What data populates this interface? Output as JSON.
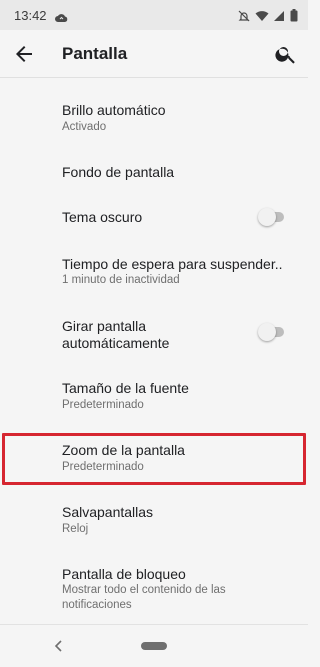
{
  "status_bar": {
    "time": "13:42",
    "icons": [
      "cloud-sync-icon",
      "mute-icon",
      "wifi-icon",
      "signal-icon",
      "battery-icon"
    ]
  },
  "app_bar": {
    "title": "Pantalla",
    "back_icon": "arrow-back-icon",
    "search_icon": "search-icon"
  },
  "settings": {
    "items": [
      {
        "title": "Brillo automático",
        "subtitle": "Activado"
      },
      {
        "title": "Fondo de pantalla"
      },
      {
        "title": "Tema oscuro",
        "toggle": false
      },
      {
        "title": "Tiempo de espera para suspender..",
        "subtitle": "1 minuto de inactividad"
      },
      {
        "title": "Girar pantalla automáticamente",
        "toggle": false
      },
      {
        "title": "Tamaño de la fuente",
        "subtitle": "Predeterminado"
      },
      {
        "title": "Zoom de la pantalla",
        "subtitle": "Predeterminado"
      },
      {
        "title": "Salvapantallas",
        "subtitle": "Reloj"
      },
      {
        "title": "Pantalla de bloqueo",
        "subtitle": "Mostrar todo el contenido de las notificaciones"
      }
    ]
  },
  "colors": {
    "highlight": "#d62630",
    "background": "#f5f5f5"
  }
}
